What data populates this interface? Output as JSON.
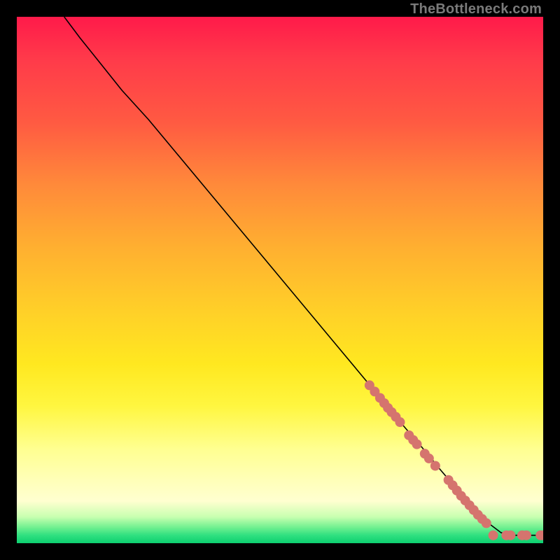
{
  "watermark": "TheBottleneck.com",
  "colors": {
    "marker": "#d5746e",
    "marker_stroke": "#c45a58",
    "line": "#000000"
  },
  "chart_data": {
    "type": "line",
    "title": "",
    "xlabel": "",
    "ylabel": "",
    "xlim": [
      0,
      100
    ],
    "ylim": [
      0,
      100
    ],
    "grid": false,
    "legend": false,
    "series": [
      {
        "name": "curve",
        "x": [
          9,
          12,
          16,
          20,
          25,
          30,
          35,
          40,
          45,
          50,
          55,
          60,
          65,
          70,
          72,
          75,
          78,
          80,
          83,
          86,
          88,
          90,
          92,
          94,
          96,
          98,
          100
        ],
        "y": [
          100,
          96,
          91,
          86,
          80.5,
          74.5,
          68.5,
          62.5,
          56.5,
          50.5,
          44.5,
          38.5,
          32.5,
          26.5,
          24,
          20.5,
          17,
          14.5,
          11,
          7.5,
          5.5,
          3.5,
          2,
          1.5,
          1.5,
          1.5,
          1.5
        ]
      }
    ],
    "markers": {
      "name": "points",
      "x": [
        67,
        68,
        69,
        69.8,
        70.5,
        71.2,
        72,
        72.8,
        74.5,
        75.3,
        76,
        77.5,
        78.3,
        79.5,
        82,
        82.8,
        83.6,
        84.4,
        85.2,
        86,
        86.8,
        87.6,
        88.4,
        89.2,
        90.5,
        93,
        93.8,
        96,
        96.8,
        99.5,
        100
      ],
      "y": [
        30,
        28.8,
        27.6,
        26.6,
        25.7,
        24.9,
        24,
        23,
        20.5,
        19.6,
        18.8,
        17,
        16.1,
        14.7,
        12,
        11,
        10,
        9,
        8.1,
        7.2,
        6.3,
        5.4,
        4.6,
        3.8,
        1.5,
        1.5,
        1.5,
        1.5,
        1.5,
        1.5,
        1.5
      ]
    }
  }
}
